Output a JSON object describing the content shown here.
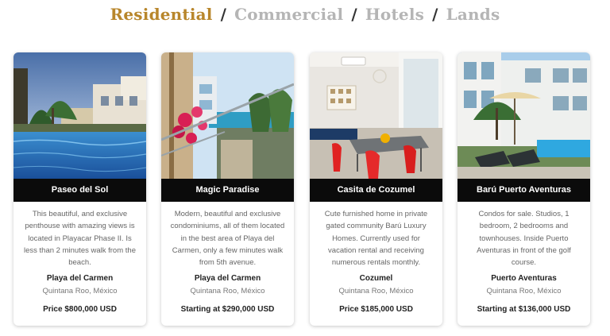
{
  "tabs": [
    {
      "label": "Residential",
      "active": true
    },
    {
      "label": "Commercial",
      "active": false
    },
    {
      "label": "Hotels",
      "active": false
    },
    {
      "label": "Lands",
      "active": false
    }
  ],
  "separator": "/",
  "colors": {
    "active_tab": "#b8862b",
    "inactive_tab": "#b5b5b5",
    "title_bar": "#0b0b0b"
  },
  "properties": [
    {
      "name": "Paseo del Sol",
      "description": "This beautiful, and exclusive penthouse with amazing views is located in Playacar Phase II. Is less than 2 minutes walk from the beach.",
      "city": "Playa del Carmen",
      "region": "Quintana Roo, México",
      "price": "Price $800,000 USD"
    },
    {
      "name": "Magic Paradise",
      "description": "Modern, beautiful and exclusive condominiums, all of them located in the best area of Playa del Carmen, only a few minutes walk from 5th avenue.",
      "city": "Playa del Carmen",
      "region": "Quintana Roo, México",
      "price": "Starting at $290,000 USD"
    },
    {
      "name": "Casita de Cozumel",
      "description": "Cute furnished home in private gated community Barú Luxury Homes. Currently used for vacation rental and receiving numerous rentals monthly.",
      "city": "Cozumel",
      "region": "Quintana Roo, México",
      "price": "Price $185,000 USD"
    },
    {
      "name": "Barú Puerto Aventuras",
      "description": "Condos for sale. Studios, 1 bedroom, 2 bedrooms and townhouses. Inside Puerto Aventuras in front of the golf course.",
      "city": "Puerto Aventuras",
      "region": "Quintana Roo, México",
      "price": "Starting at $136,000 USD"
    }
  ]
}
